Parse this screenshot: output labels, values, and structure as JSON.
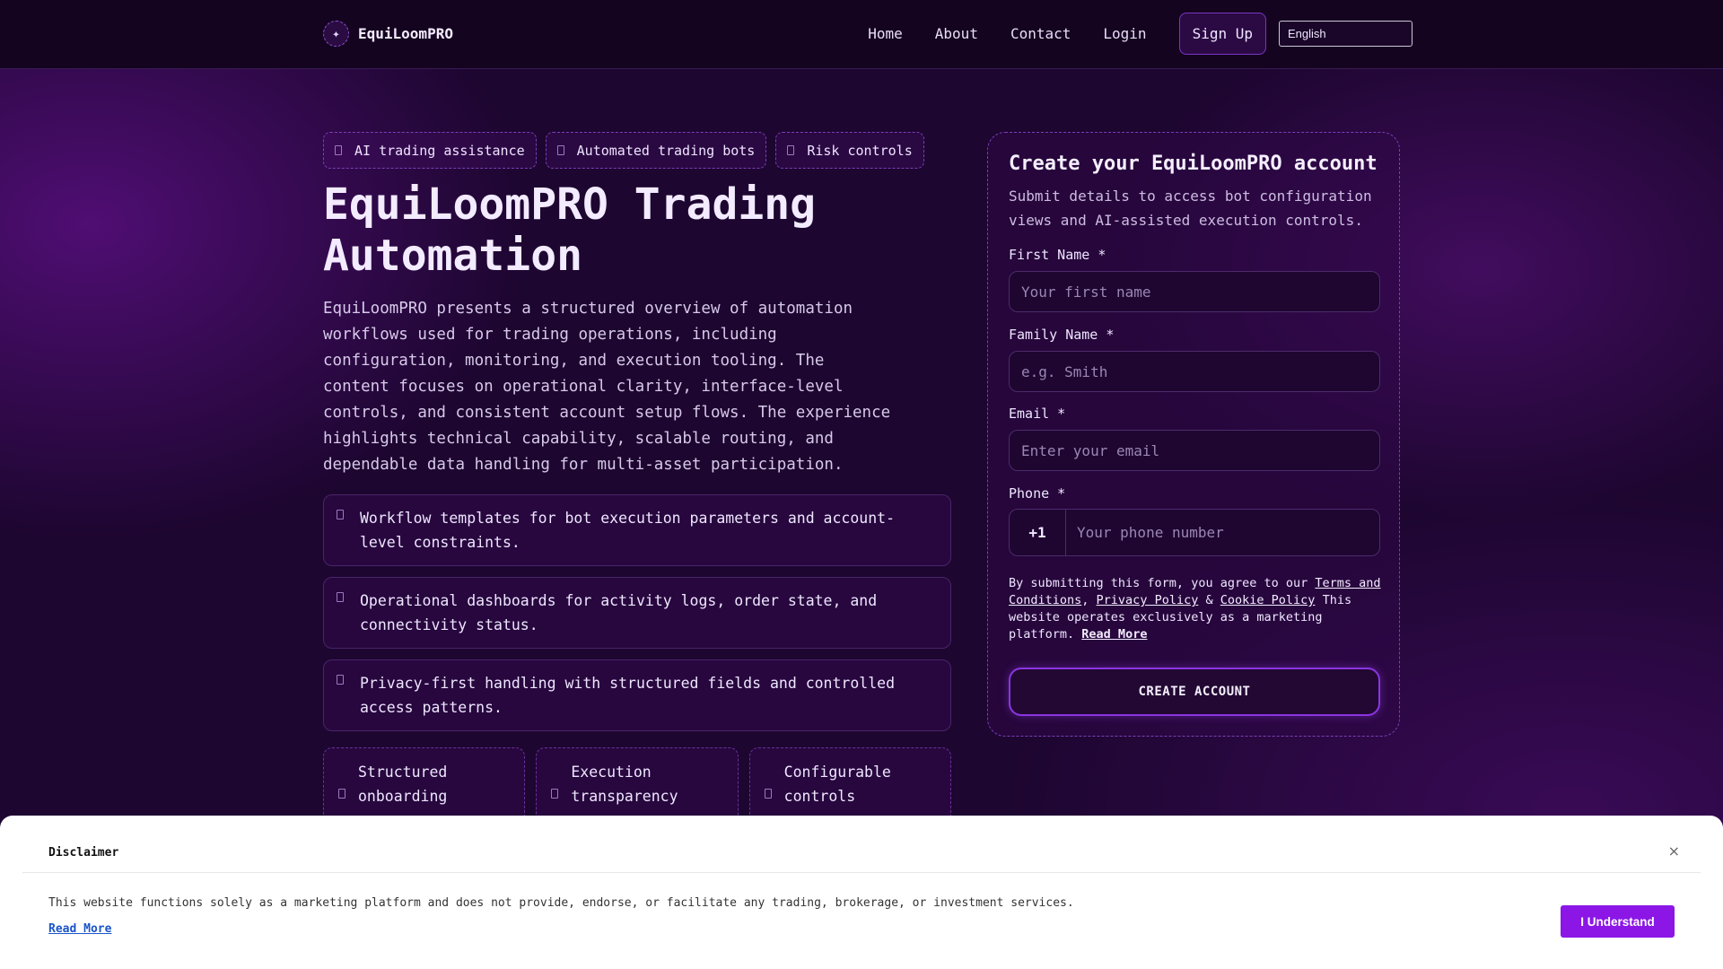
{
  "nav": {
    "brand": "EquiLoomPRO",
    "brand_icon": "sparkle-icon",
    "links": [
      "Home",
      "About",
      "Contact",
      "Login"
    ],
    "signup": "Sign Up",
    "language": "English"
  },
  "hero": {
    "chips": [
      "AI trading assistance",
      "Automated trading bots",
      "Risk controls"
    ],
    "title": "EquiLoomPRO Trading Automation",
    "description": "EquiLoomPRO presents a structured overview of automation workflows used for trading operations, including configuration, monitoring, and execution tooling. The content focuses on operational clarity, interface-level controls, and consistent account setup flows. The experience highlights technical capability, scalable routing, and dependable data handling for multi-asset participation.",
    "features": [
      "Workflow templates for bot execution parameters and account-level constraints.",
      "Operational dashboards for activity logs, order state, and connectivity status.",
      "Privacy-first handling with structured fields and controlled access patterns."
    ],
    "tiles": [
      "Structured onboarding",
      "Execution transparency",
      "Configurable controls"
    ]
  },
  "form": {
    "title": "Create your EquiLoomPRO account",
    "subtitle": "Submit details to access bot configuration views and AI-assisted execution controls.",
    "first_name_label": "First Name *",
    "first_name_placeholder": "Your first name",
    "family_name_label": "Family Name *",
    "family_name_placeholder": "e.g. Smith",
    "email_label": "Email *",
    "email_placeholder": "Enter your email",
    "phone_label": "Phone *",
    "phone_code": "+1",
    "phone_placeholder": "Your phone number",
    "legal_prefix": "By submitting this form, you agree to our",
    "terms": "Terms and Conditions",
    "privacy": "Privacy Policy",
    "amp": "&",
    "cookie": "Cookie Policy",
    "legal_suffix": "This website operates exclusively as a marketing platform.",
    "read_more": "Read More",
    "submit": "CREATE ACCOUNT"
  },
  "disclaimer": {
    "title": "Disclaimer",
    "text": "This website functions solely as a marketing platform and does not provide, endorse, or facilitate any trading, brokerage, or investment services.",
    "read_more": "Read More",
    "button": "I Understand",
    "close": "×"
  }
}
